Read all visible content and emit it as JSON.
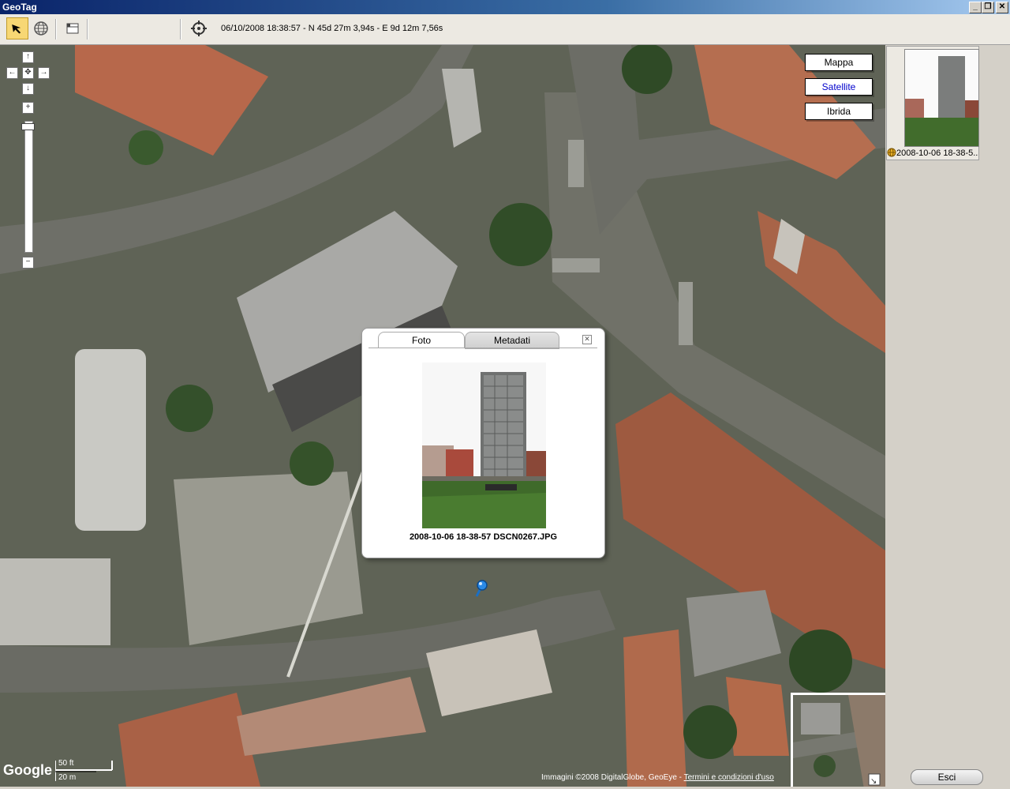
{
  "window": {
    "title": "GeoTag"
  },
  "toolbar": {
    "coordinates": "06/10/2008 18:38:57 - N 45d 27m 3,94s - E 9d 12m 7,56s"
  },
  "map_types": [
    {
      "label": "Mappa",
      "selected": false
    },
    {
      "label": "Satellite",
      "selected": true
    },
    {
      "label": "Ibrida",
      "selected": false
    }
  ],
  "popup": {
    "tabs": [
      {
        "label": "Foto",
        "active": true
      },
      {
        "label": "Metadati",
        "active": false
      }
    ],
    "caption": "2008-10-06 18-38-57 DSCN0267.JPG"
  },
  "thumbnails": [
    {
      "label": "2008-10-06 18-38-5..."
    }
  ],
  "scale": {
    "feet": "50 ft",
    "meters": "20 m"
  },
  "footer": {
    "imagery": "Immagini ©2008 DigitalGlobe, GeoEye - ",
    "terms_link": "Termini e condizioni d'uso"
  },
  "logo_text": "Google",
  "buttons": {
    "exit": "Esci"
  },
  "colors": {
    "selected_map_type": "#0000cc",
    "active_tool": "#f7d774"
  }
}
